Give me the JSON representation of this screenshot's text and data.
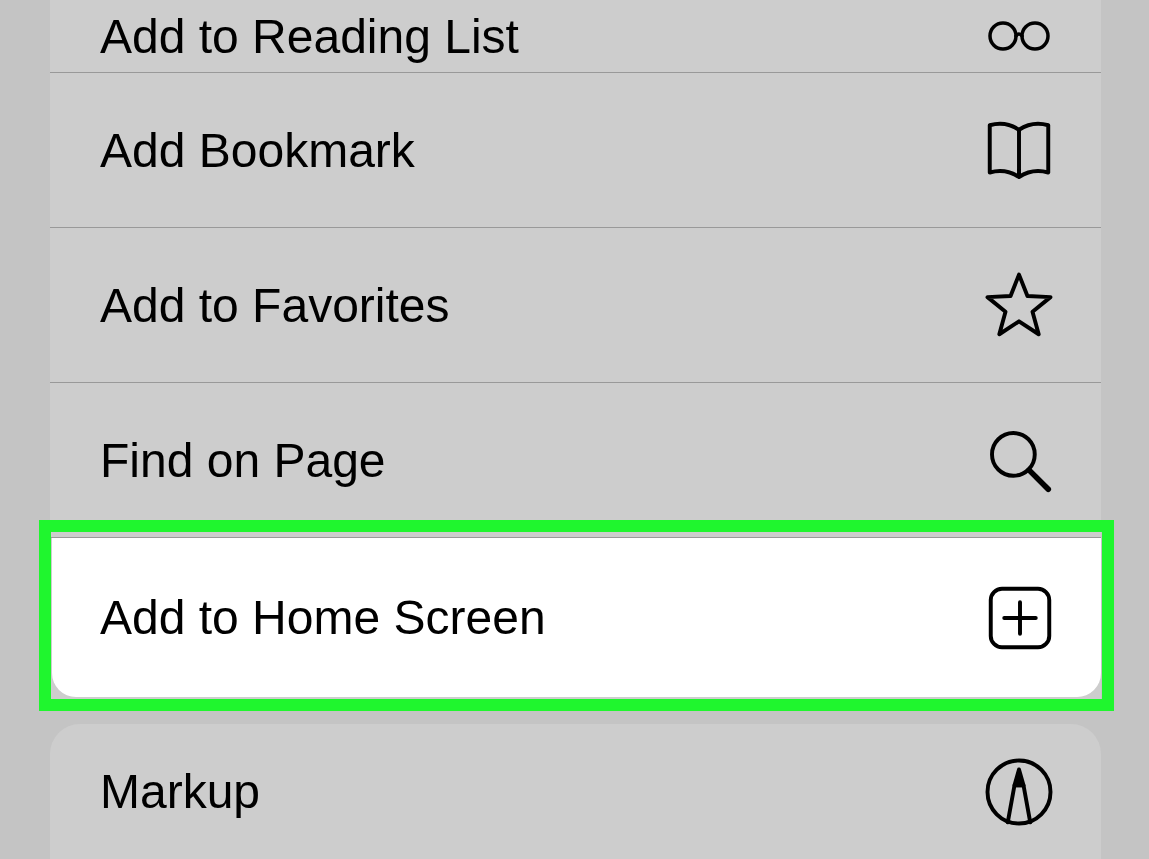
{
  "action_groups": [
    {
      "items": [
        {
          "label": "Add to Reading List",
          "kind": "glasses",
          "highlighted": false
        },
        {
          "label": "Add Bookmark",
          "kind": "book",
          "highlighted": false
        },
        {
          "label": "Add to Favorites",
          "kind": "star",
          "highlighted": false
        },
        {
          "label": "Find on Page",
          "kind": "search",
          "highlighted": false
        },
        {
          "label": "Add to Home Screen",
          "kind": "add-square",
          "highlighted": true
        }
      ]
    },
    {
      "items": [
        {
          "label": "Markup",
          "kind": "pen-circle",
          "highlighted": false
        }
      ]
    }
  ]
}
